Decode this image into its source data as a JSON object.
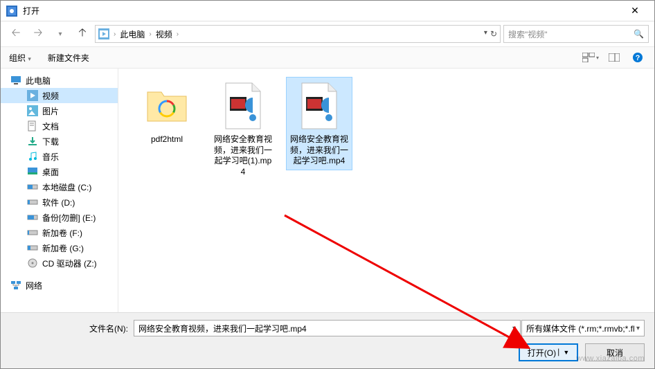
{
  "titlebar": {
    "title": "打开"
  },
  "breadcrumb": {
    "root": "此电脑",
    "sub": "视频"
  },
  "search": {
    "placeholder": "搜索\"视频\""
  },
  "toolbar": {
    "organize": "组织",
    "newfolder": "新建文件夹"
  },
  "tree": {
    "thispc": "此电脑",
    "videos": "视频",
    "pictures": "图片",
    "documents": "文档",
    "downloads": "下载",
    "music": "音乐",
    "desktop": "桌面",
    "drivec": "本地磁盘 (C:)",
    "drived": "软件 (D:)",
    "drivee": "备份[勿删] (E:)",
    "drivef": "新加卷 (F:)",
    "driveg": "新加卷 (G:)",
    "drivez": "CD 驱动器 (Z:)",
    "network": "网络"
  },
  "files": [
    {
      "name": "pdf2html",
      "type": "folder"
    },
    {
      "name": "网络安全教育视频，进来我们一起学习吧(1).mp4",
      "type": "video"
    },
    {
      "name": "网络安全教育视频，进来我们一起学习吧.mp4",
      "type": "video",
      "selected": true
    }
  ],
  "bottom": {
    "filename_label": "文件名(N):",
    "filename_value": "网络安全教育视频，进来我们一起学习吧.mp4",
    "filter": "所有媒体文件 (*.rm;*.rmvb;*.fl",
    "open": "打开(O)",
    "cancel": "取消"
  },
  "watermark": "www.xiazaiba.com"
}
